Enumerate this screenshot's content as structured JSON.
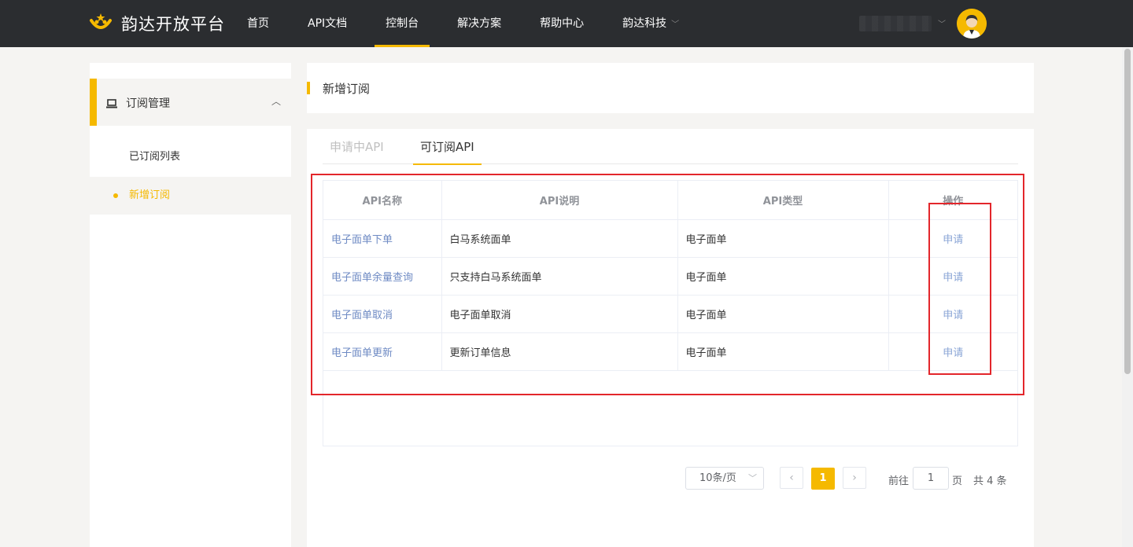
{
  "brand": {
    "name": "韵达开放平台",
    "accent": "#f5b900"
  },
  "nav": {
    "items": [
      {
        "label": "首页"
      },
      {
        "label": "API文档"
      },
      {
        "label": "控制台"
      },
      {
        "label": "解决方案"
      },
      {
        "label": "帮助中心"
      },
      {
        "label": "韵达科技"
      }
    ]
  },
  "sidebar": {
    "group_label": "订阅管理",
    "items": [
      {
        "label": "已订阅列表"
      },
      {
        "label": "新增订阅"
      }
    ]
  },
  "page": {
    "title": "新增订阅"
  },
  "tabs": [
    {
      "label": "申请中API"
    },
    {
      "label": "可订阅API"
    }
  ],
  "table": {
    "columns": [
      "API名称",
      "API说明",
      "API类型",
      "操作"
    ],
    "rows": [
      {
        "name": "电子面单下单",
        "desc": "白马系统面单",
        "type": "电子面单",
        "action": "申请"
      },
      {
        "name": "电子面单余量查询",
        "desc": "只支持白马系统面单",
        "type": "电子面单",
        "action": "申请"
      },
      {
        "name": "电子面单取消",
        "desc": "电子面单取消",
        "type": "电子面单",
        "action": "申请"
      },
      {
        "name": "电子面单更新",
        "desc": "更新订单信息",
        "type": "电子面单",
        "action": "申请"
      }
    ]
  },
  "pagination": {
    "page_size": "10条/页",
    "current_page": "1",
    "goto_label": "前往",
    "goto_value": "1",
    "page_unit": "页",
    "total": "共 4 条"
  },
  "annotation_color": "#e3262b"
}
